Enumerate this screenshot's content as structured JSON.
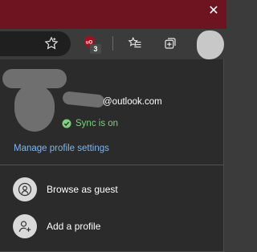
{
  "window": {
    "close_glyph": "✕"
  },
  "toolbar": {
    "icons": [
      "star-icon",
      "ublock-icon",
      "favorites-icon",
      "collections-icon",
      "profile-avatar"
    ],
    "ublock_badge": "3"
  },
  "profile": {
    "email_suffix": "@outlook.com",
    "sync_status": "Sync is on",
    "manage_link": "Manage profile settings"
  },
  "menu": {
    "items": [
      {
        "label": "Browse as guest",
        "icon": "guest-icon"
      },
      {
        "label": "Add a profile",
        "icon": "add-profile-icon"
      }
    ]
  },
  "colors": {
    "titlebar": "#6d1420",
    "panel_bg": "#2b2b2b",
    "sync_green": "#7fcf7f",
    "link_blue": "#7fb6ee"
  }
}
